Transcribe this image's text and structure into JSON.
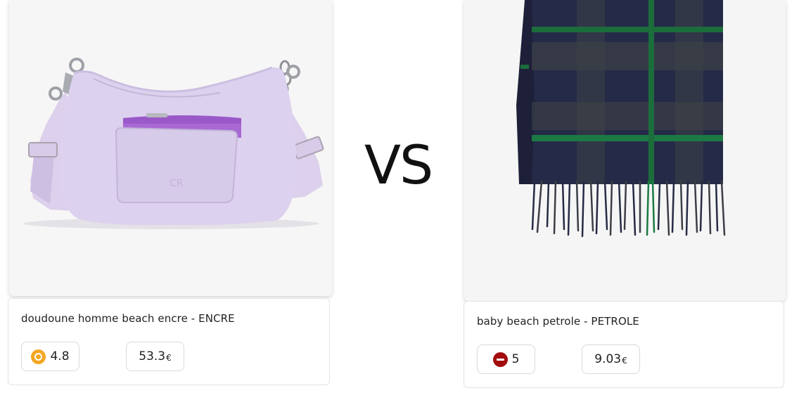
{
  "comparison": {
    "separator": "VS",
    "left": {
      "title": "doudoune homme beach encre - ENCRE",
      "score": "4.8",
      "score_icon": "good-score-icon",
      "score_color": "#f5a623",
      "price": "53.3",
      "currency": "€",
      "image": "lilac-shoulder-bag-image",
      "monogram": "CR"
    },
    "right": {
      "title": "baby beach petrole - PETROLE",
      "score": "5",
      "score_icon": "bad-score-icon",
      "score_color": "#a30d0d",
      "price": "9.03",
      "currency": "€",
      "image": "plaid-scarf-image"
    }
  }
}
